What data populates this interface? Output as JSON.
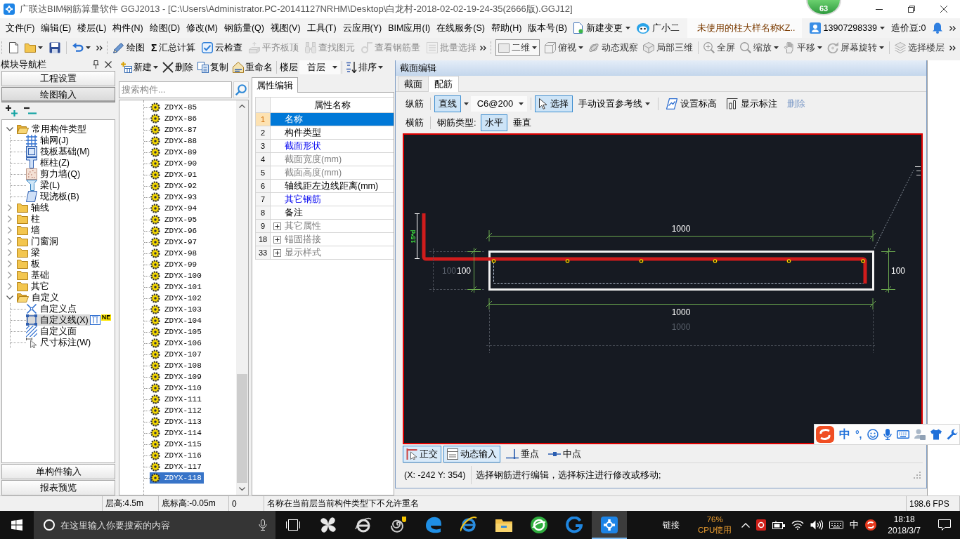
{
  "title_bar": {
    "title": "广联达BIM钢筋算量软件 GGJ2013 - [C:\\Users\\Administrator.PC-20141127NRHM\\Desktop\\白龙村-2018-02-02-19-24-35(2666版).GGJ12]",
    "badge": "63"
  },
  "menu_bar": {
    "items": [
      "文件(F)",
      "编辑(E)",
      "楼层(L)",
      "构件(N)",
      "绘图(D)",
      "修改(M)",
      "钢筋量(Q)",
      "视图(V)",
      "工具(T)",
      "云应用(Y)",
      "BIM应用(I)",
      "在线服务(S)",
      "帮助(H)",
      "版本号(B)"
    ],
    "change": "新建变更",
    "assistant": "广小二",
    "notice": "未使用的柱大样名称KZ..",
    "account": "13907298339",
    "beans": "造价豆:0"
  },
  "toolbar": {
    "bands": [
      [
        [
          {
            "kind": "new",
            "menu": false,
            "disabled": false
          },
          {
            "kind": "open",
            "menu": true,
            "disabled": false
          },
          {
            "kind": "save",
            "menu": false,
            "disabled": false
          }
        ],
        [
          {
            "kind": "undo",
            "menu": true,
            "disabled": false
          }
        ]
      ],
      [
        [
          {
            "kind": "draw",
            "label": "绘图",
            "menu": false,
            "disabled": false
          },
          {
            "kind": "sum",
            "symbol": "Σ",
            "label": "汇总计算",
            "menu": false,
            "disabled": false
          },
          {
            "kind": "check",
            "label": "云检查",
            "menu": false,
            "disabled": false
          },
          {
            "kind": "align",
            "label": "平齐板顶",
            "menu": false,
            "disabled": true
          },
          {
            "kind": "find",
            "label": "查找图元",
            "menu": false,
            "disabled": true
          },
          {
            "kind": "rebar",
            "label": "查看钢筋量",
            "menu": false,
            "disabled": true
          },
          {
            "kind": "batch",
            "label": "批量选择",
            "menu": false,
            "disabled": true
          }
        ]
      ],
      [
        [
          {
            "kind": "view",
            "label": "二维",
            "menu": true,
            "disabled": false
          },
          {
            "kind": "top",
            "label": "俯视",
            "menu": true,
            "disabled": false
          },
          {
            "kind": "orbit",
            "label": "动态观察",
            "menu": false,
            "disabled": false
          },
          {
            "kind": "local",
            "label": "局部三维",
            "menu": false,
            "disabled": false
          }
        ],
        [
          {
            "kind": "fullscreen",
            "label": "全屏",
            "menu": false,
            "disabled": false
          },
          {
            "kind": "zoom",
            "label": "缩放",
            "menu": true,
            "disabled": false
          },
          {
            "kind": "pan",
            "label": "平移",
            "menu": true,
            "disabled": false
          },
          {
            "kind": "rotate",
            "label": "屏幕旋转",
            "menu": true,
            "disabled": false
          }
        ],
        [
          {
            "kind": "floor",
            "label": "选择楼层",
            "menu": false,
            "disabled": false
          }
        ]
      ]
    ]
  },
  "nav": {
    "header": "模块导航栏",
    "modules": [
      {
        "label": "工程设置",
        "selected": false
      },
      {
        "label": "绘图输入",
        "selected": true
      },
      {
        "label": "单构件输入",
        "selected": false
      },
      {
        "label": "报表预览",
        "selected": false
      }
    ],
    "tree": [
      {
        "label": "常用构件类型",
        "expanded": true,
        "selected": false,
        "children": [
          {
            "kind": "grid",
            "label": "轴网(J)",
            "selected": false
          },
          {
            "kind": "raft",
            "label": "筏板基础(M)",
            "selected": false
          },
          {
            "kind": "column",
            "label": "框柱(Z)",
            "selected": false
          },
          {
            "kind": "wall",
            "label": "剪力墙(Q)",
            "selected": false
          },
          {
            "kind": "beam",
            "label": "梁(L)",
            "selected": false
          },
          {
            "kind": "slab",
            "label": "现浇板(B)",
            "selected": false
          }
        ]
      },
      {
        "label": "轴线",
        "expanded": false,
        "selected": false
      },
      {
        "label": "柱",
        "expanded": false,
        "selected": false
      },
      {
        "label": "墙",
        "expanded": false,
        "selected": false
      },
      {
        "label": "门窗洞",
        "expanded": false,
        "selected": false
      },
      {
        "label": "梁",
        "expanded": false,
        "selected": false
      },
      {
        "label": "板",
        "expanded": false,
        "selected": false
      },
      {
        "label": "基础",
        "expanded": false,
        "selected": false
      },
      {
        "label": "其它",
        "expanded": false,
        "selected": false
      },
      {
        "label": "自定义",
        "expanded": true,
        "selected": false,
        "children": [
          {
            "kind": "point",
            "label": "自定义点",
            "selected": false
          },
          {
            "kind": "line",
            "label": "自定义线(X)",
            "selected": true,
            "badge": "NE"
          },
          {
            "kind": "area",
            "label": "自定义面",
            "selected": false
          },
          {
            "kind": "dimension",
            "label": "尺寸标注(W)",
            "selected": false
          }
        ]
      }
    ]
  },
  "components": {
    "toolbar": {
      "actions": [
        {
          "kind": "new",
          "label": "新建",
          "menu": true
        },
        {
          "kind": "delete",
          "label": "删除",
          "menu": false
        },
        {
          "kind": "copy",
          "label": "复制",
          "menu": false
        },
        {
          "kind": "rename",
          "label": "重命名",
          "menu": false
        }
      ],
      "floor_label": "楼层",
      "floor": "首层",
      "sort": {
        "label": "排序",
        "menu": true
      }
    },
    "search": {
      "placeholder": "搜索构件..."
    },
    "items": [
      {
        "label": "ZDYX-85",
        "selected": false
      },
      {
        "label": "ZDYX-86",
        "selected": false
      },
      {
        "label": "ZDYX-87",
        "selected": false
      },
      {
        "label": "ZDYX-88",
        "selected": false
      },
      {
        "label": "ZDYX-89",
        "selected": false
      },
      {
        "label": "ZDYX-90",
        "selected": false
      },
      {
        "label": "ZDYX-91",
        "selected": false
      },
      {
        "label": "ZDYX-92",
        "selected": false
      },
      {
        "label": "ZDYX-93",
        "selected": false
      },
      {
        "label": "ZDYX-94",
        "selected": false
      },
      {
        "label": "ZDYX-95",
        "selected": false
      },
      {
        "label": "ZDYX-96",
        "selected": false
      },
      {
        "label": "ZDYX-97",
        "selected": false
      },
      {
        "label": "ZDYX-98",
        "selected": false
      },
      {
        "label": "ZDYX-99",
        "selected": false
      },
      {
        "label": "ZDYX-100",
        "selected": false
      },
      {
        "label": "ZDYX-101",
        "selected": false
      },
      {
        "label": "ZDYX-102",
        "selected": false
      },
      {
        "label": "ZDYX-103",
        "selected": false
      },
      {
        "label": "ZDYX-104",
        "selected": false
      },
      {
        "label": "ZDYX-105",
        "selected": false
      },
      {
        "label": "ZDYX-106",
        "selected": false
      },
      {
        "label": "ZDYX-107",
        "selected": false
      },
      {
        "label": "ZDYX-108",
        "selected": false
      },
      {
        "label": "ZDYX-109",
        "selected": false
      },
      {
        "label": "ZDYX-110",
        "selected": false
      },
      {
        "label": "ZDYX-111",
        "selected": false
      },
      {
        "label": "ZDYX-112",
        "selected": false
      },
      {
        "label": "ZDYX-113",
        "selected": false
      },
      {
        "label": "ZDYX-114",
        "selected": false
      },
      {
        "label": "ZDYX-115",
        "selected": false
      },
      {
        "label": "ZDYX-116",
        "selected": false
      },
      {
        "label": "ZDYX-117",
        "selected": false
      },
      {
        "label": "ZDYX-118",
        "selected": true
      }
    ]
  },
  "properties": {
    "tab": "属性编辑",
    "header": "属性名称",
    "rows": [
      {
        "number": "1",
        "label": "名称",
        "kind": "plain",
        "selected": true
      },
      {
        "number": "2",
        "label": "构件类型",
        "kind": "plain",
        "selected": false
      },
      {
        "number": "3",
        "label": "截面形状",
        "kind": "link",
        "selected": false
      },
      {
        "number": "4",
        "label": "截面宽度(mm)",
        "kind": "readonly",
        "selected": false
      },
      {
        "number": "5",
        "label": "截面高度(mm)",
        "kind": "readonly",
        "selected": false
      },
      {
        "number": "6",
        "label": "轴线距左边线距离(mm)",
        "kind": "plain",
        "selected": false
      },
      {
        "number": "7",
        "label": "其它钢筋",
        "kind": "link",
        "selected": false
      },
      {
        "number": "8",
        "label": "备注",
        "kind": "plain",
        "selected": false
      },
      {
        "number": "9",
        "label": "其它属性",
        "kind": "group",
        "selected": false
      },
      {
        "number": "18",
        "label": "锚固搭接",
        "kind": "group",
        "selected": false
      },
      {
        "number": "33",
        "label": "显示样式",
        "kind": "group",
        "selected": false
      }
    ]
  },
  "section_editor": {
    "title": "截面编辑",
    "tabs": [
      {
        "label": "截面",
        "selected": false
      },
      {
        "label": "配筋",
        "selected": true
      }
    ],
    "longitudinal": {
      "label": "纵筋",
      "shape": {
        "label": "直线",
        "pressed": true
      },
      "spec": "C6@200",
      "tools": [
        {
          "kind": "select",
          "label": "选择",
          "pressed": true,
          "menu": false,
          "disabled": false
        },
        {
          "kind": "guide",
          "label": "手动设置参考线",
          "pressed": false,
          "menu": true,
          "disabled": false
        },
        {
          "kind": "elevation",
          "label": "设置标高",
          "pressed": false,
          "menu": false,
          "disabled": false
        },
        {
          "kind": "annotate",
          "label": "显示标注",
          "pressed": false,
          "menu": false,
          "disabled": false
        },
        {
          "kind": "delete",
          "label": "删除",
          "pressed": false,
          "menu": false,
          "disabled": true
        }
      ]
    },
    "transverse": {
      "label": "横筋",
      "type_label": "钢筋类型:",
      "types": [
        {
          "label": "水平",
          "selected": true
        },
        {
          "label": "垂直",
          "selected": false
        }
      ]
    },
    "canvas": {
      "labels": [
        {
          "kind": "hook",
          "text": "15*d"
        },
        {
          "kind": "top",
          "text": "1000"
        },
        {
          "kind": "ghostleft",
          "text": "100"
        },
        {
          "kind": "left",
          "text": "100"
        },
        {
          "kind": "right",
          "text": "100"
        },
        {
          "kind": "bottom",
          "text": "1000"
        },
        {
          "kind": "ghostbottom",
          "text": "1000"
        }
      ]
    },
    "snaps": [
      {
        "kind": "ortho",
        "label": "正交",
        "on": true
      },
      {
        "kind": "dynamic",
        "label": "动态输入",
        "on": true
      },
      {
        "kind": "perpendicular",
        "label": "垂点",
        "on": false
      },
      {
        "kind": "midpoint",
        "label": "中点",
        "on": false
      }
    ],
    "coords": "(X: -242 Y: 354)",
    "hint": "选择钢筋进行编辑，选择标注进行修改或移动;"
  },
  "ime": {
    "mode": "中",
    "punctuation": "°,"
  },
  "status_bar": {
    "floor_height": "层高:4.5m",
    "base_elevation": "底标高:-0.05m",
    "count": "0",
    "message": "名称在当前层当前构件类型下不允许重名",
    "fps": "198.6 FPS"
  },
  "taskbar": {
    "search": {
      "placeholder": "在这里输入你要搜索的内容"
    },
    "apps": [
      {
        "kind": "pinwheel",
        "active": false
      },
      {
        "kind": "browser",
        "active": false
      },
      {
        "kind": "spiral",
        "active": false
      },
      {
        "kind": "edge",
        "active": false
      },
      {
        "kind": "ie",
        "active": false
      },
      {
        "kind": "explorer",
        "active": false
      },
      {
        "kind": "globe",
        "active": false
      },
      {
        "kind": "glodon",
        "active": false
      },
      {
        "kind": "app",
        "active": true
      }
    ],
    "links": "链接",
    "cpu": "76%",
    "cpu_label": "CPU使用",
    "ime": "中",
    "time": "18:18",
    "date": "2018/3/7"
  }
}
